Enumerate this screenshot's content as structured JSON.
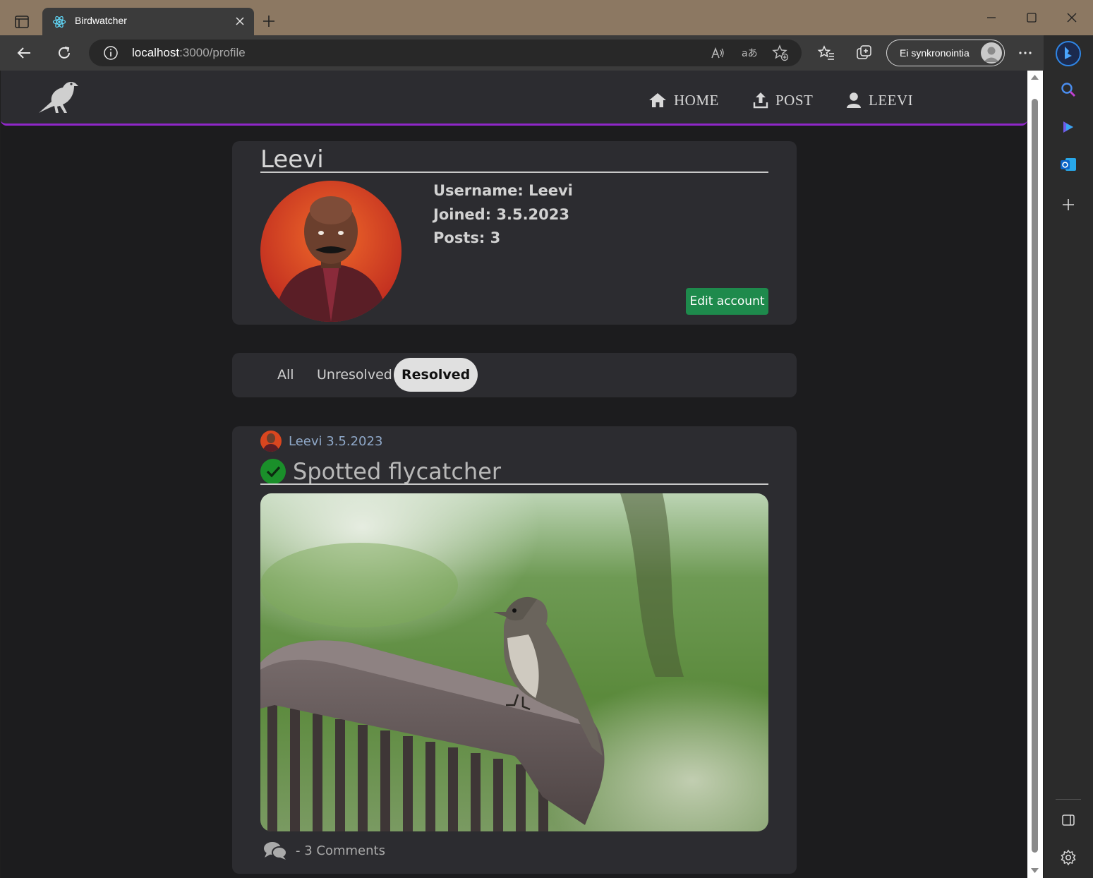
{
  "browser": {
    "tab_title": "Birdwatcher",
    "url_host": "localhost",
    "url_path": ":3000/profile",
    "sync_label": "Ei synkronointia",
    "frame_color": "#8c7862"
  },
  "nav": {
    "items": [
      {
        "label": "HOME",
        "icon": "home-icon"
      },
      {
        "label": "POST",
        "icon": "upload-icon"
      },
      {
        "label": "LEEVI",
        "icon": "user-icon"
      }
    ],
    "accent": "#9027c9"
  },
  "profile": {
    "name": "Leevi",
    "username_line": "Username: Leevi",
    "joined_line": "Joined: 3.5.2023",
    "posts_line": "Posts: 3",
    "edit_label": "Edit account",
    "edit_color": "#1e8a4c"
  },
  "filters": {
    "items": [
      "All",
      "Unresolved",
      "Resolved"
    ],
    "active": "Resolved"
  },
  "post": {
    "author_line": "Leevi 3.5.2023",
    "title": "Spotted flycatcher",
    "comments_label": "- 3 Comments",
    "resolved_color": "#1a8f2a"
  }
}
